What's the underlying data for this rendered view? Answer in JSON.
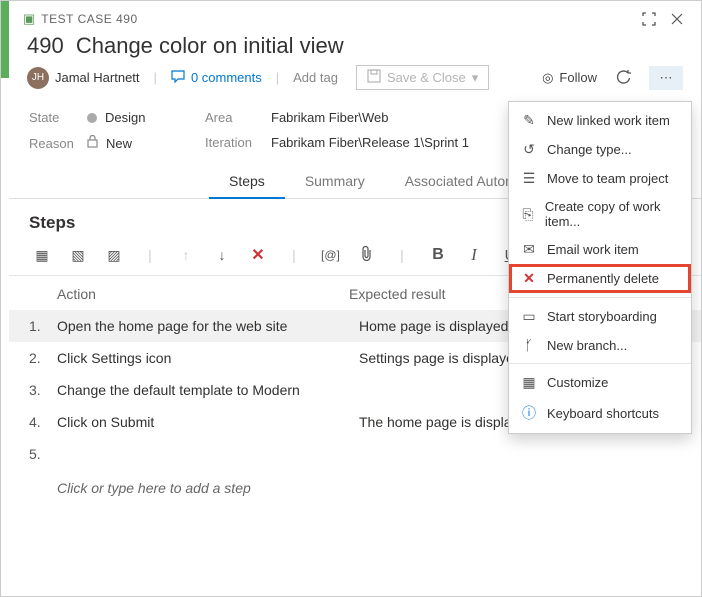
{
  "titlebar": {
    "kind": "TEST CASE",
    "id": "490"
  },
  "headline": {
    "id": "490",
    "title": "Change color on initial view"
  },
  "meta": {
    "person": "Jamal Hartnett",
    "initials": "JH",
    "comments": "0 comments",
    "addtag": "Add tag",
    "save": "Save & Close",
    "follow": "Follow"
  },
  "details": {
    "state_label": "State",
    "state_value": "Design",
    "reason_label": "Reason",
    "reason_value": "New",
    "area_label": "Area",
    "area_value": "Fabrikam Fiber\\Web",
    "iteration_label": "Iteration",
    "iteration_value": "Fabrikam Fiber\\Release 1\\Sprint 1"
  },
  "tabs": {
    "steps": "Steps",
    "summary": "Summary",
    "assoc": "Associated Automation"
  },
  "steps_heading": "Steps",
  "grid": {
    "action": "Action",
    "expected": "Expected result"
  },
  "steps": [
    {
      "n": "1.",
      "action": "Open the home page for the web site",
      "expected": "Home page is displayed"
    },
    {
      "n": "2.",
      "action": "Click Settings icon",
      "expected": "Settings page is displayed"
    },
    {
      "n": "3.",
      "action": "Change the default template to Modern",
      "expected": ""
    },
    {
      "n": "4.",
      "action": "Click on Submit",
      "expected": "The home page is displayed with the Modern look"
    },
    {
      "n": "5.",
      "action": "",
      "expected": ""
    }
  ],
  "placeholder": "Click or type here to add a step",
  "ctx": {
    "new_linked": "New linked work item",
    "change_type": "Change type...",
    "move": "Move to team project",
    "copy": "Create copy of work item...",
    "email": "Email work item",
    "delete": "Permanently delete",
    "storyboard": "Start storyboarding",
    "branch": "New branch...",
    "customize": "Customize",
    "shortcuts": "Keyboard shortcuts"
  }
}
